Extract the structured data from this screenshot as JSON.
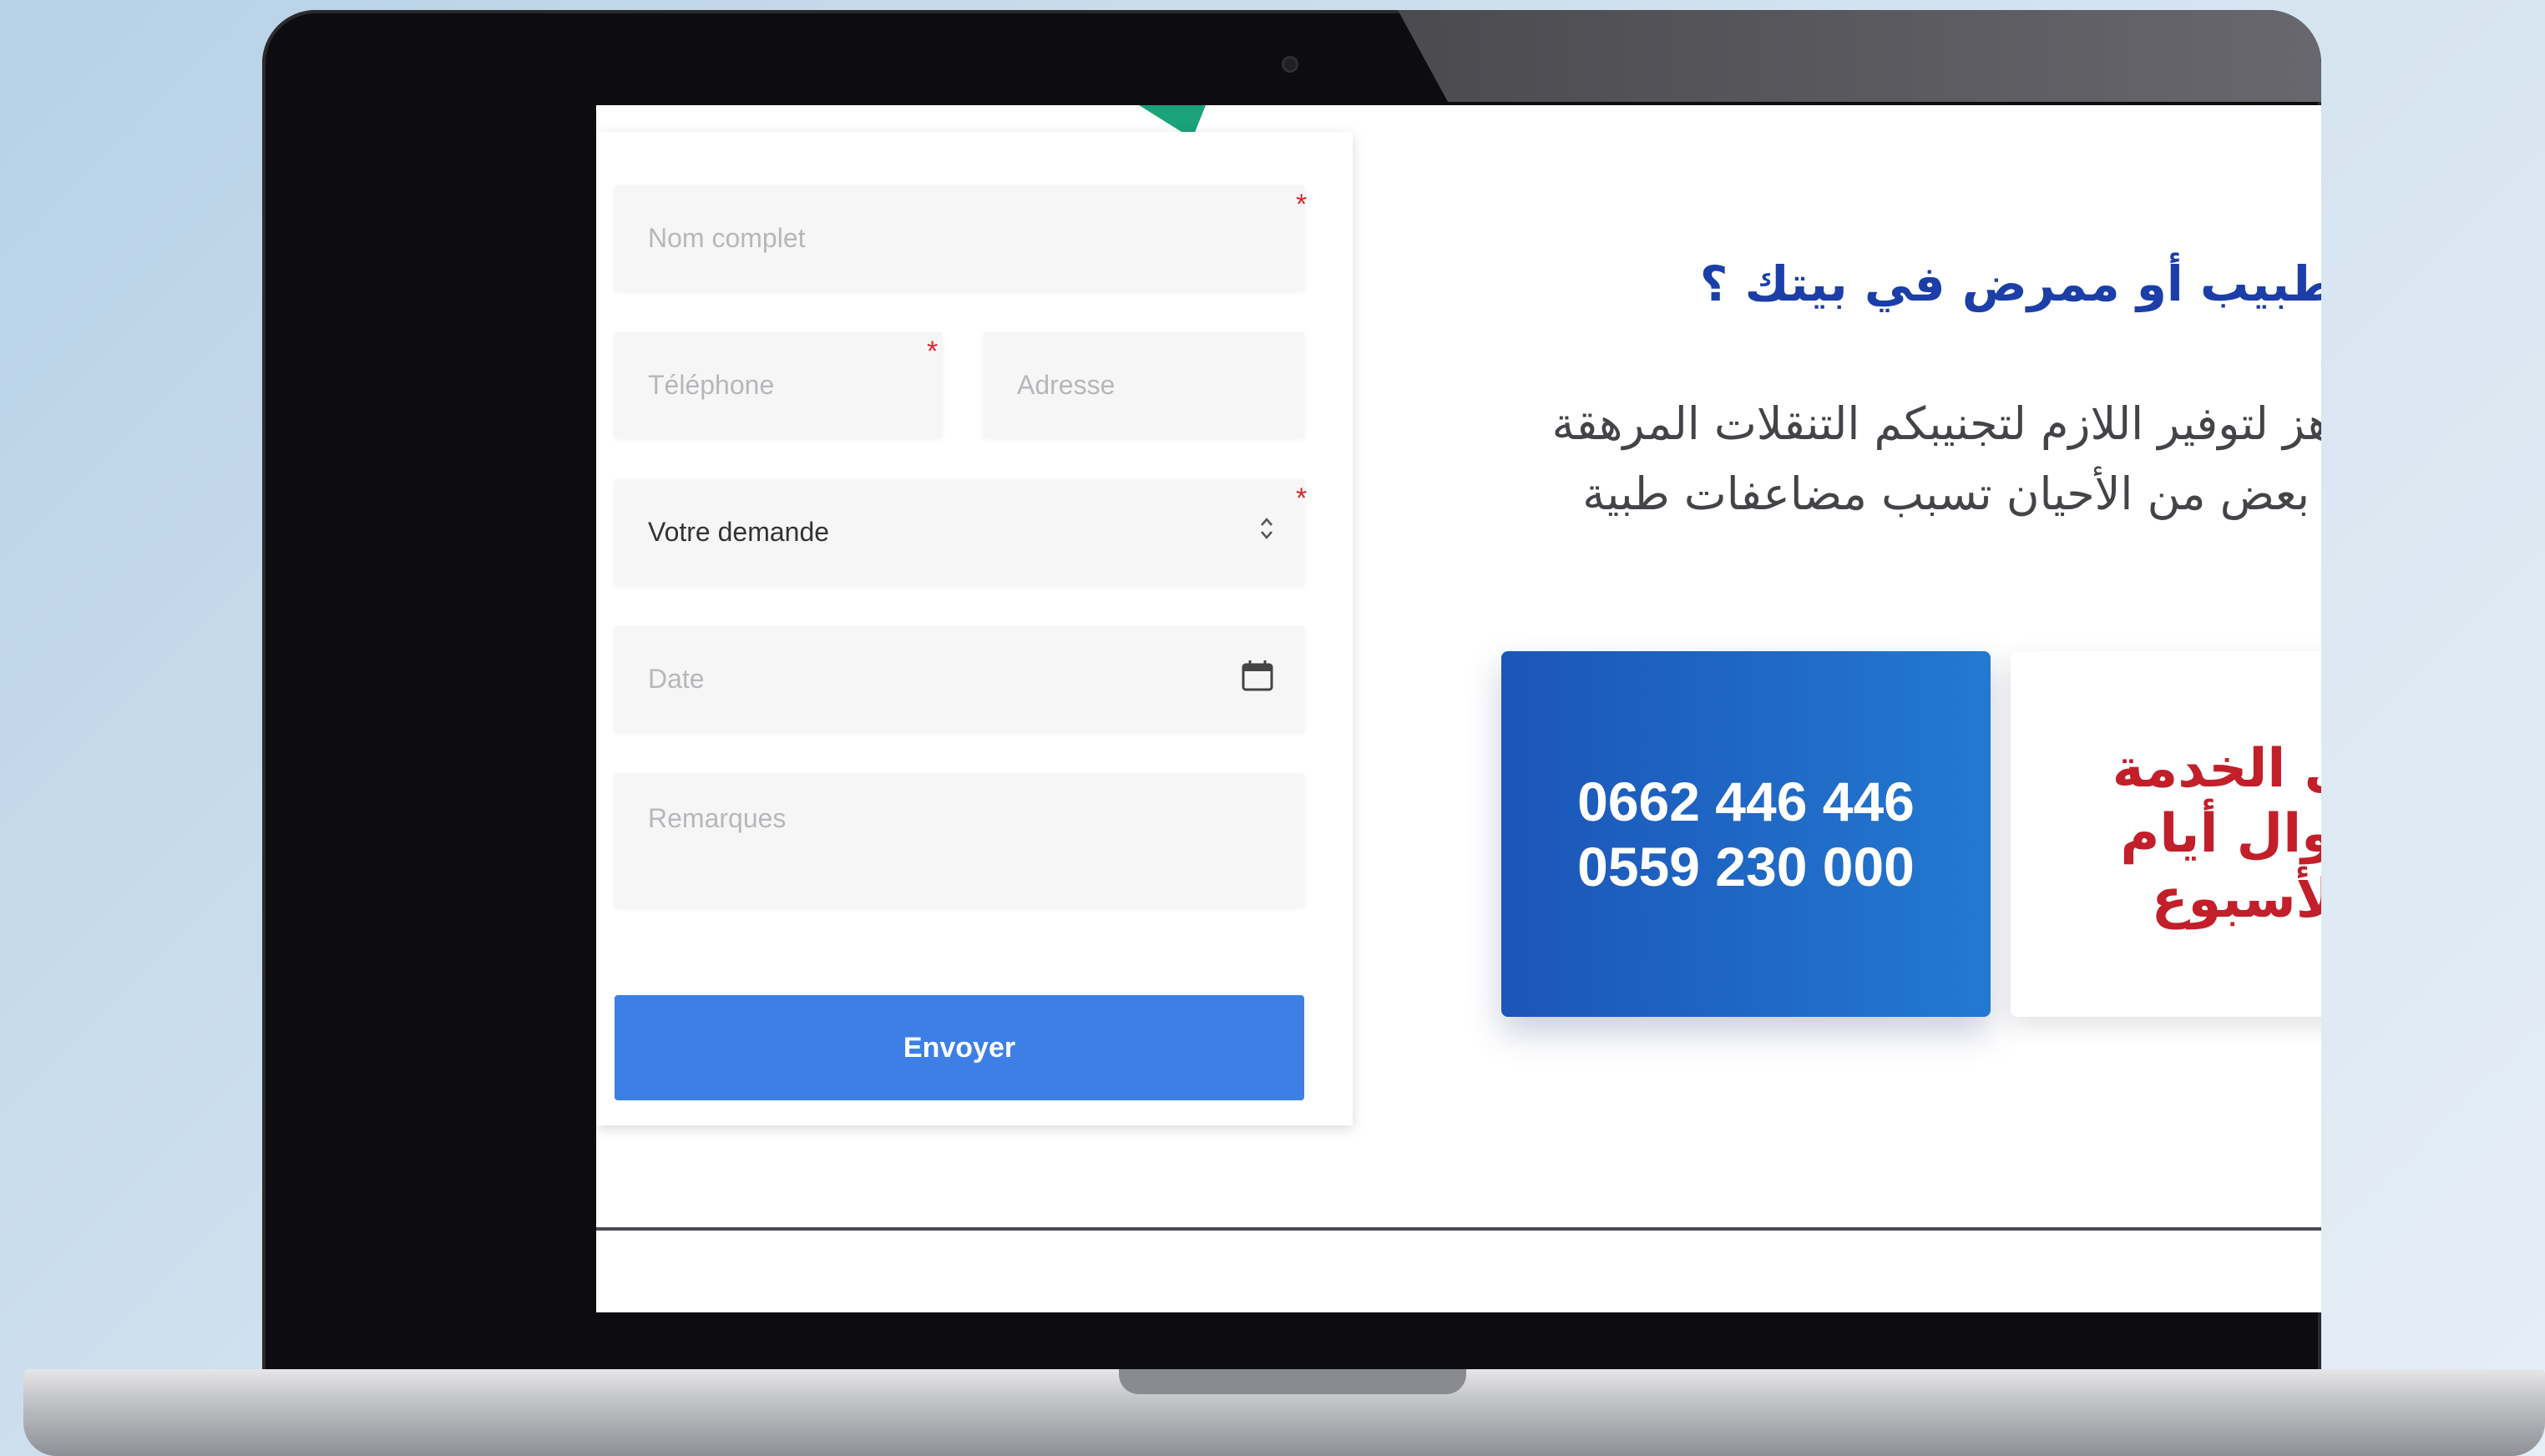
{
  "form": {
    "full_name_placeholder": "Nom complet",
    "phone_placeholder": "Téléphone",
    "address_placeholder": "Adresse",
    "request_value": "Votre demande",
    "date_placeholder": "Date",
    "remarks_placeholder": "Remarques",
    "submit_label": "Envoyer",
    "required_marker": "*"
  },
  "content": {
    "heading": "يلزمك طبيب أو ممرض في بيتك ؟",
    "description": "فريقنا جاهز لتوفير اللازم لتجنيبكم التنقلات المرهقة والتي في بعض من الأحيان تسبب مضاعفات طبية",
    "phone_1": "0662 446 446",
    "phone_2": "0559 230 000",
    "service_line_1": "في الخدمة",
    "service_line_2": "طوال أيام",
    "service_line_3": "الأسبوع"
  },
  "colors": {
    "accent_blue": "#3d7fe6",
    "heading_blue": "#1b3ea8",
    "service_red": "#c21f2a",
    "required_red": "#d9262f"
  }
}
